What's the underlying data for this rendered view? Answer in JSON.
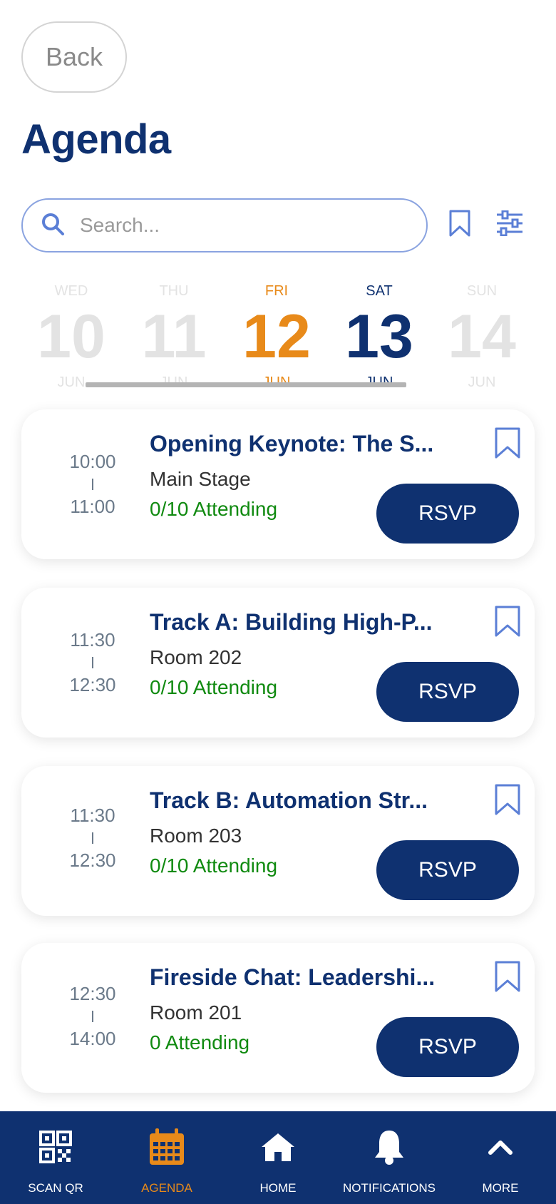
{
  "header": {
    "back_label": "Back",
    "title": "Agenda"
  },
  "search": {
    "placeholder": "Search..."
  },
  "colors": {
    "primary": "#0f3170",
    "accent": "#e88a1a",
    "success": "#108a10"
  },
  "dates": [
    {
      "dow": "WED",
      "num": "10",
      "mon": "JUN",
      "state": "dim"
    },
    {
      "dow": "THU",
      "num": "11",
      "mon": "JUN",
      "state": "dim"
    },
    {
      "dow": "FRI",
      "num": "12",
      "mon": "JUN",
      "state": "active"
    },
    {
      "dow": "SAT",
      "num": "13",
      "mon": "JUN",
      "state": "available"
    },
    {
      "dow": "SUN",
      "num": "14",
      "mon": "JUN",
      "state": "dim"
    }
  ],
  "sessions": [
    {
      "start": "10:00",
      "end": "11:00",
      "title": "Opening Keynote: The S...",
      "room": "Main Stage",
      "attending": "0/10 Attending",
      "rsvp": "RSVP"
    },
    {
      "start": "11:30",
      "end": "12:30",
      "title": "Track A: Building High-P...",
      "room": "Room 202",
      "attending": "0/10 Attending",
      "rsvp": "RSVP"
    },
    {
      "start": "11:30",
      "end": "12:30",
      "title": "Track B: Automation Str...",
      "room": "Room 203",
      "attending": "0/10 Attending",
      "rsvp": "RSVP"
    },
    {
      "start": "12:30",
      "end": "14:00",
      "title": "Fireside Chat: Leadershi...",
      "room": "Room 201",
      "attending": "0 Attending",
      "rsvp": "RSVP"
    }
  ],
  "tabs": [
    {
      "label": "SCAN QR",
      "icon": "qr-code-icon"
    },
    {
      "label": "AGENDA",
      "icon": "calendar-icon"
    },
    {
      "label": "HOME",
      "icon": "home-icon"
    },
    {
      "label": "NOTIFICATIONS",
      "icon": "bell-icon"
    },
    {
      "label": "MORE",
      "icon": "chevron-up-icon"
    }
  ]
}
